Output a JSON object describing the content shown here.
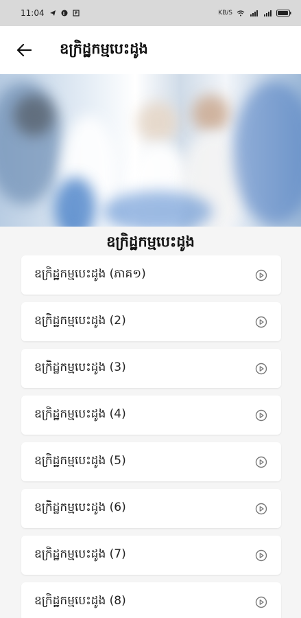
{
  "status_bar": {
    "time": "11:04",
    "icons": [
      "telegram-icon",
      "pinterest-icon",
      "p-icon",
      "data-speed-icon",
      "wifi-icon",
      "signal-icon",
      "signal-icon",
      "battery-icon"
    ],
    "speed_text": "KB/S"
  },
  "app_bar": {
    "back_icon": "arrow-left-icon",
    "title": "ឧក្រិដ្ឋកម្មបេះដូង"
  },
  "banner": {
    "image": "blurred-scene-image"
  },
  "section_heading": "ឧក្រិដ្ឋកម្មបេះដូង",
  "episodes": [
    {
      "label": "ឧក្រិដ្ឋកម្មបេះដូង (ភាគ១)",
      "icon": "play-circle-icon"
    },
    {
      "label": "ឧក្រិដ្ឋកម្មបេះដូង (2)",
      "icon": "play-circle-icon"
    },
    {
      "label": "ឧក្រិដ្ឋកម្មបេះដូង (3)",
      "icon": "play-circle-icon"
    },
    {
      "label": "ឧក្រិដ្ឋកម្មបេះដូង (4)",
      "icon": "play-circle-icon"
    },
    {
      "label": "ឧក្រិដ្ឋកម្មបេះដូង (5)",
      "icon": "play-circle-icon"
    },
    {
      "label": "ឧក្រិដ្ឋកម្មបេះដូង (6)",
      "icon": "play-circle-icon"
    },
    {
      "label": "ឧក្រិដ្ឋកម្មបេះដូង (7)",
      "icon": "play-circle-icon"
    },
    {
      "label": "ឧក្រិដ្ឋកម្មបេះដូង (8)",
      "icon": "play-circle-icon"
    }
  ],
  "colors": {
    "status_bar_bg": "#d9d9d9",
    "app_bar_bg": "#ffffff",
    "page_bg": "#f5f5f5",
    "card_bg": "#ffffff",
    "icon_gray": "#777777"
  }
}
